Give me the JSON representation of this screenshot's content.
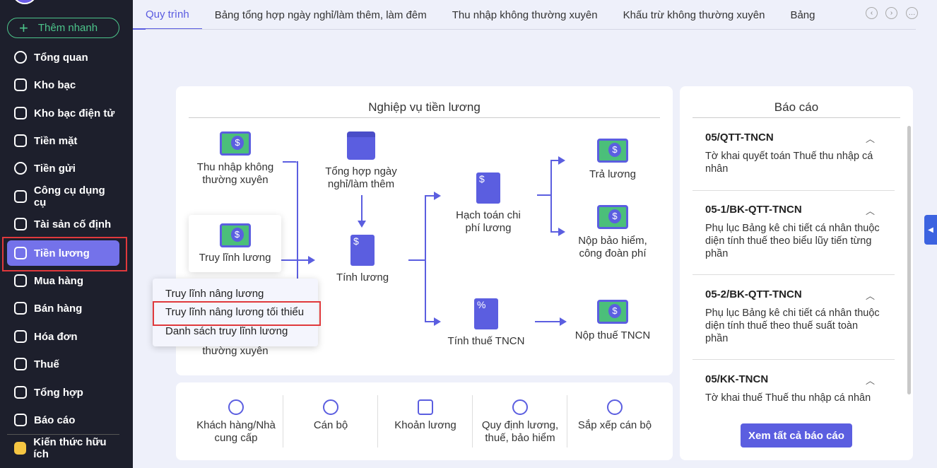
{
  "sidebar": {
    "quick_add": "Thêm nhanh",
    "items": [
      {
        "label": "Tổng quan"
      },
      {
        "label": "Kho bạc"
      },
      {
        "label": "Kho bạc điện tử"
      },
      {
        "label": "Tiền mặt"
      },
      {
        "label": "Tiền gửi"
      },
      {
        "label": "Công cụ dụng cụ"
      },
      {
        "label": "Tài sản cố định"
      },
      {
        "label": "Tiền lương"
      },
      {
        "label": "Mua hàng"
      },
      {
        "label": "Bán hàng"
      },
      {
        "label": "Hóa đơn"
      },
      {
        "label": "Thuế"
      },
      {
        "label": "Tổng hợp"
      },
      {
        "label": "Báo cáo"
      }
    ],
    "knowledge": "Kiến thức hữu ích",
    "active": "Tiền lương"
  },
  "tabs": [
    "Quy trình",
    "Bảng tổng hợp ngày nghỉ/làm thêm, làm đêm",
    "Thu nhập không thường xuyên",
    "Khấu trừ không thường xuyên",
    "Bảng"
  ],
  "flow": {
    "title": "Nghiệp vụ tiền lương",
    "nodes": {
      "thu_nhap": "Thu nhập không thường xuyên",
      "tong_hop": "Tổng hợp ngày nghỉ/làm thêm",
      "truy_linh": "Truy lĩnh lương",
      "tinh_luong": "Tính lương",
      "hach_toan": "Hạch toán chi phí lương",
      "tra_luong": "Trả lương",
      "nop_bh": "Nộp bảo hiểm, công đoàn phí",
      "tinh_thue": "Tính thuế TNCN",
      "nop_thue": "Nộp thuế TNCN",
      "hidden_tail": "thường xuyên"
    },
    "menu": [
      "Truy lĩnh nâng lương",
      "Truy lĩnh nâng lương tối thiểu",
      "Danh sách truy lĩnh lương"
    ]
  },
  "shortcuts": [
    "Khách hàng/Nhà cung cấp",
    "Cán bộ",
    "Khoản lương",
    "Quy định lương, thuế, bảo hiểm",
    "Sắp xếp cán bộ"
  ],
  "reports": {
    "title": "Báo cáo",
    "items": [
      {
        "code": "05/QTT-TNCN",
        "desc": "Tờ khai quyết toán Thuế thu nhập cá nhân"
      },
      {
        "code": "05-1/BK-QTT-TNCN",
        "desc": "Phụ lục Bảng kê chi tiết cá nhân thuộc diện tính thuế theo biểu lũy tiến từng phần"
      },
      {
        "code": "05-2/BK-QTT-TNCN",
        "desc": "Phụ lục Bảng kê chi tiết cá nhân thuộc diện tính thuế theo thuế suất toàn phần"
      },
      {
        "code": "05/KK-TNCN",
        "desc": "Tờ khai thuế Thuế thu nhập cá nhân"
      }
    ],
    "view_all": "Xem tất cả báo cáo"
  },
  "colors": {
    "accent": "#5b5ee0",
    "sidebar": "#1d1f2c",
    "active": "#7472ea",
    "highlight": "#e0393c"
  }
}
